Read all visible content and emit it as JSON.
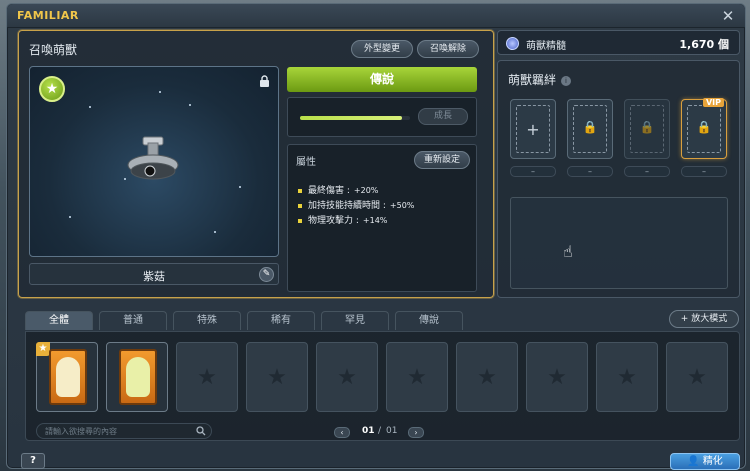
{
  "window": {
    "title": "FAMILIAR"
  },
  "summon": {
    "title": "召喚萌獸",
    "appearance_button": "外型變更",
    "release_button": "召喚解除",
    "name": "紫菇",
    "rank": "傳說",
    "growth": {
      "button": "成長",
      "progress": 0.93
    }
  },
  "attributes": {
    "title": "屬性",
    "reset_button": "重新設定",
    "items": [
      {
        "label": "最終傷害 :",
        "value": "+20%"
      },
      {
        "label": "加持技能持續時間 :",
        "value": "+50%"
      },
      {
        "label": "物理攻擊力 :",
        "value": "+14%"
      }
    ]
  },
  "essence": {
    "label": "萌獸精髓",
    "value": "1,670",
    "unit": "個"
  },
  "bond": {
    "title": "萌獸羈絆",
    "info_icon": "i",
    "slots": [
      {
        "glyph": "+",
        "label": "–"
      },
      {
        "glyph": "🔒",
        "label": "–"
      },
      {
        "glyph": "🔒",
        "label": "–"
      },
      {
        "glyph": "🔒",
        "label": "–",
        "vip": "VIP"
      }
    ]
  },
  "tabs": [
    "全體",
    "普通",
    "特殊",
    "稀有",
    "罕見",
    "傳說"
  ],
  "zoom_button": "+ 放大模式",
  "search": {
    "placeholder": "請輸入欲搜尋的內容"
  },
  "pager": {
    "current": "01",
    "separator": "/",
    "total": "01",
    "prev": "‹",
    "next": "›"
  },
  "help_button": "?",
  "refine_button": "精化",
  "colors": {
    "accent_gold": "#f0c64a",
    "rank_green": "#a8d53a",
    "refine_blue": "#2a6fb8",
    "vip_orange": "#e8a43a"
  }
}
